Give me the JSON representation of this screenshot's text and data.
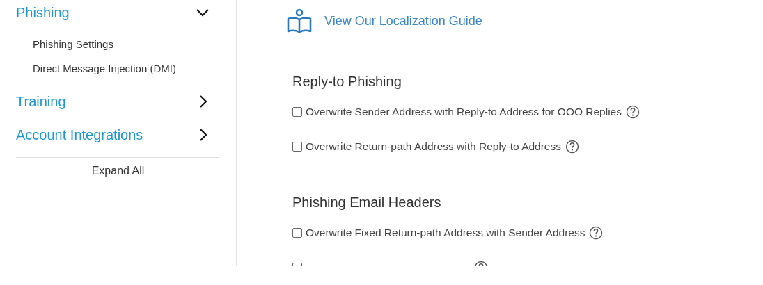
{
  "sidebar": {
    "items": [
      {
        "label": "Phishing",
        "expanded": true,
        "children": [
          {
            "label": "Phishing Settings"
          },
          {
            "label": "Direct Message Injection (DMI)"
          }
        ]
      },
      {
        "label": "Training",
        "expanded": false
      },
      {
        "label": "Account Integrations",
        "expanded": false
      }
    ],
    "expand_all": "Expand All"
  },
  "main": {
    "guide_link": "View Our Localization Guide",
    "sections": [
      {
        "heading": "Reply-to Phishing",
        "options": [
          {
            "label": "Overwrite Sender Address with Reply-to Address for OOO Replies",
            "checked": false
          },
          {
            "label": "Overwrite Return-path Address with Reply-to Address",
            "checked": false
          }
        ]
      },
      {
        "heading": "Phishing Email Headers",
        "options": [
          {
            "label": "Overwrite Fixed Return-path Address with Sender Address",
            "checked": false
          },
          {
            "checked": false
          }
        ]
      }
    ]
  }
}
